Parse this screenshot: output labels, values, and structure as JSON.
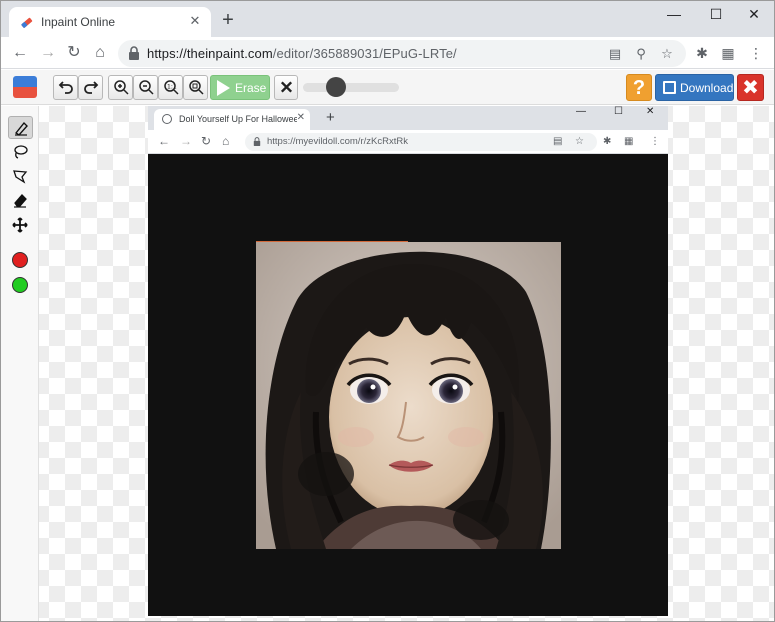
{
  "browser": {
    "tab_title": "Inpaint Online",
    "tab_close": "✕",
    "new_tab": "+",
    "url_host": "https://theinpaint.com",
    "url_path": "/editor/365889031/EPuG-LRTe/"
  },
  "app": {
    "erase_label": "Erase",
    "help_label": "?",
    "download_label": "Download",
    "close_label": "✖",
    "brush_size": 0.3,
    "colors": {
      "accent_blue": "#3476c0",
      "erase_green": "#8fd18f",
      "help_orange": "#f0a030",
      "close_red": "#d9342b",
      "mask_red": "#e02020",
      "keep_green": "#22cc22"
    }
  },
  "tools": [
    "marker-tool",
    "lasso-tool",
    "polygon-lasso-tool",
    "eraser-tool",
    "move-tool"
  ],
  "inner_browser": {
    "tab_title": "Doll Yourself Up For Halloween",
    "url": "https://myevildoll.com/r/zKcRxtRk",
    "new_tab": "+"
  }
}
